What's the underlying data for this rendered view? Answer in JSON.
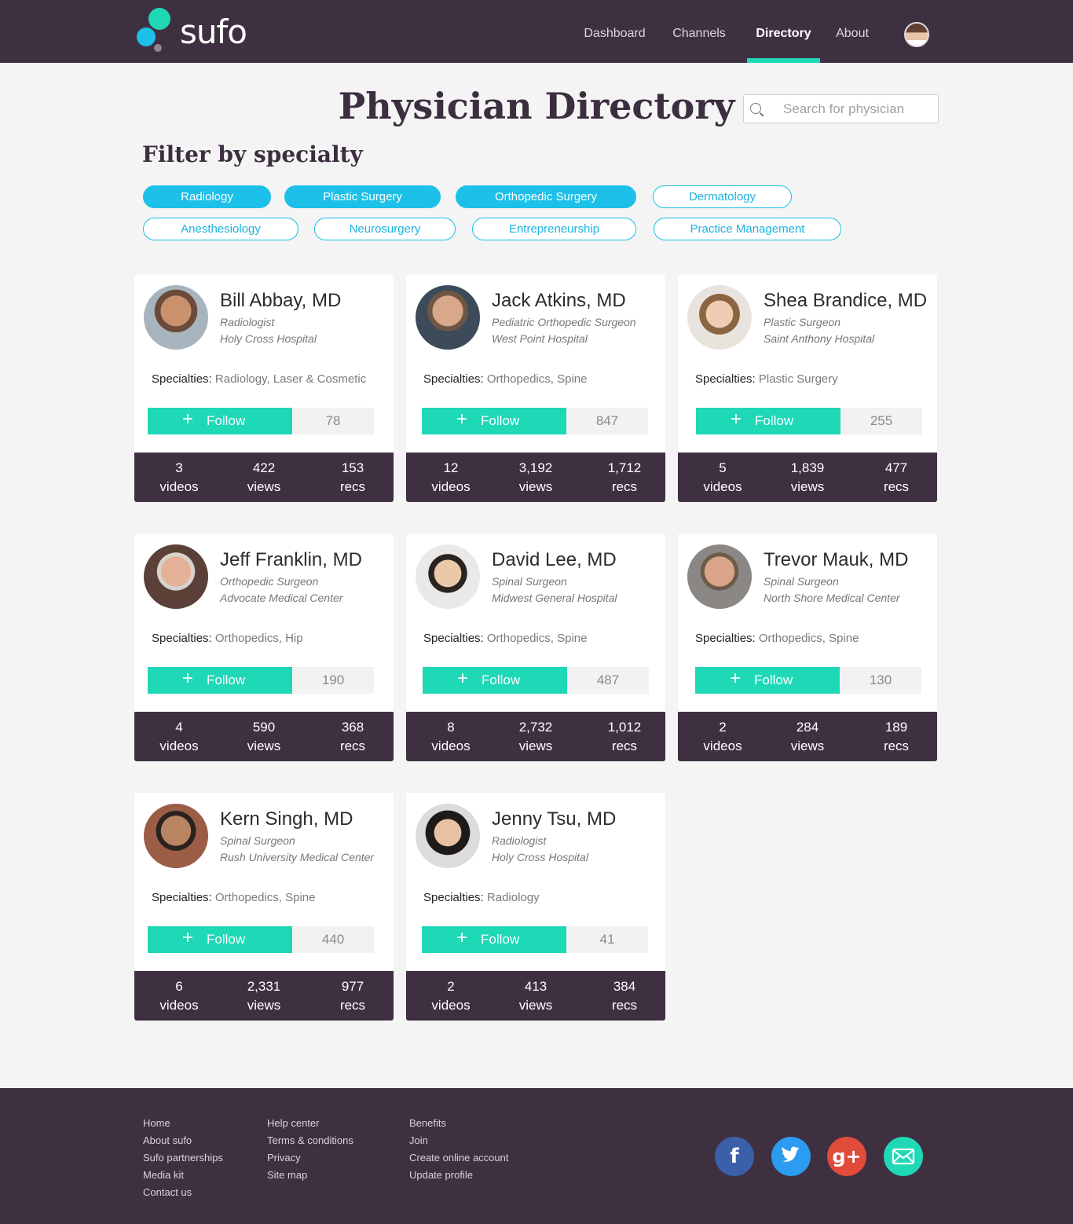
{
  "brand": {
    "name": "sufo"
  },
  "nav": {
    "items": [
      "Dashboard",
      "Channels",
      "Directory",
      "About"
    ],
    "active": "Directory"
  },
  "header": {
    "title": "Physician Directory"
  },
  "search": {
    "placeholder": "Search for physician"
  },
  "filter": {
    "title": "Filter by specialty",
    "pills": [
      {
        "label": "Radiology",
        "selected": true
      },
      {
        "label": "Plastic Surgery",
        "selected": true
      },
      {
        "label": "Orthopedic Surgery",
        "selected": true
      },
      {
        "label": "Dermatology",
        "selected": false
      },
      {
        "label": "Anesthesiology",
        "selected": false
      },
      {
        "label": "Neurosurgery",
        "selected": false
      },
      {
        "label": "Entrepreneurship",
        "selected": false
      },
      {
        "label": "Practice Management",
        "selected": false
      }
    ]
  },
  "card_labels": {
    "specialties": "Specialties:",
    "follow": "Follow",
    "videos": "videos",
    "views": "views",
    "recs": "recs"
  },
  "physicians": [
    {
      "name": "Bill Abbay, MD",
      "role": "Radiologist",
      "hospital": "Holy Cross Hospital",
      "specialties": "Radiology, Laser & Cosmetic",
      "followers": "78",
      "videos": "3",
      "views": "422",
      "recs": "153"
    },
    {
      "name": "Jack Atkins, MD",
      "role": "Pediatric Orthopedic Surgeon",
      "hospital": "West Point Hospital",
      "specialties": "Orthopedics, Spine",
      "followers": "847",
      "videos": "12",
      "views": "3,192",
      "recs": "1,712"
    },
    {
      "name": "Shea Brandice, MD",
      "role": "Plastic Surgeon",
      "hospital": "Saint Anthony Hospital",
      "specialties": "Plastic Surgery",
      "followers": "255",
      "videos": "5",
      "views": "1,839",
      "recs": "477"
    },
    {
      "name": "Jeff Franklin, MD",
      "role": "Orthopedic Surgeon",
      "hospital": "Advocate Medical Center",
      "specialties": "Orthopedics, Hip",
      "followers": "190",
      "videos": "4",
      "views": "590",
      "recs": "368"
    },
    {
      "name": "David Lee, MD",
      "role": "Spinal Surgeon",
      "hospital": "Midwest General Hospital",
      "specialties": "Orthopedics, Spine",
      "followers": "487",
      "videos": "8",
      "views": "2,732",
      "recs": "1,012"
    },
    {
      "name": "Trevor Mauk, MD",
      "role": "Spinal Surgeon",
      "hospital": "North Shore Medical Center",
      "specialties": "Orthopedics, Spine",
      "followers": "130",
      "videos": "2",
      "views": "284",
      "recs": "189"
    },
    {
      "name": "Kern Singh, MD",
      "role": "Spinal Surgeon",
      "hospital": "Rush University Medical Center",
      "specialties": "Orthopedics, Spine",
      "followers": "440",
      "videos": "6",
      "views": "2,331",
      "recs": "977"
    },
    {
      "name": "Jenny Tsu, MD",
      "role": "Radiologist",
      "hospital": "Holy Cross Hospital",
      "specialties": "Radiology",
      "followers": "41",
      "videos": "2",
      "views": "413",
      "recs": "384"
    }
  ],
  "footer": {
    "columns": [
      [
        "Home",
        "About sufo",
        "Sufo partnerships",
        "Media kit",
        "Contact us"
      ],
      [
        "Help center",
        "Terms & conditions",
        "Privacy",
        "Site map"
      ],
      [
        "Benefits",
        "Join",
        "Create online account",
        "Update profile"
      ]
    ],
    "social": [
      "facebook-icon",
      "twitter-icon",
      "google-plus-icon",
      "email-icon"
    ]
  },
  "colors": {
    "header": "#3f3041",
    "accent": "#1fd8b6",
    "pill": "#1cc0e8"
  }
}
